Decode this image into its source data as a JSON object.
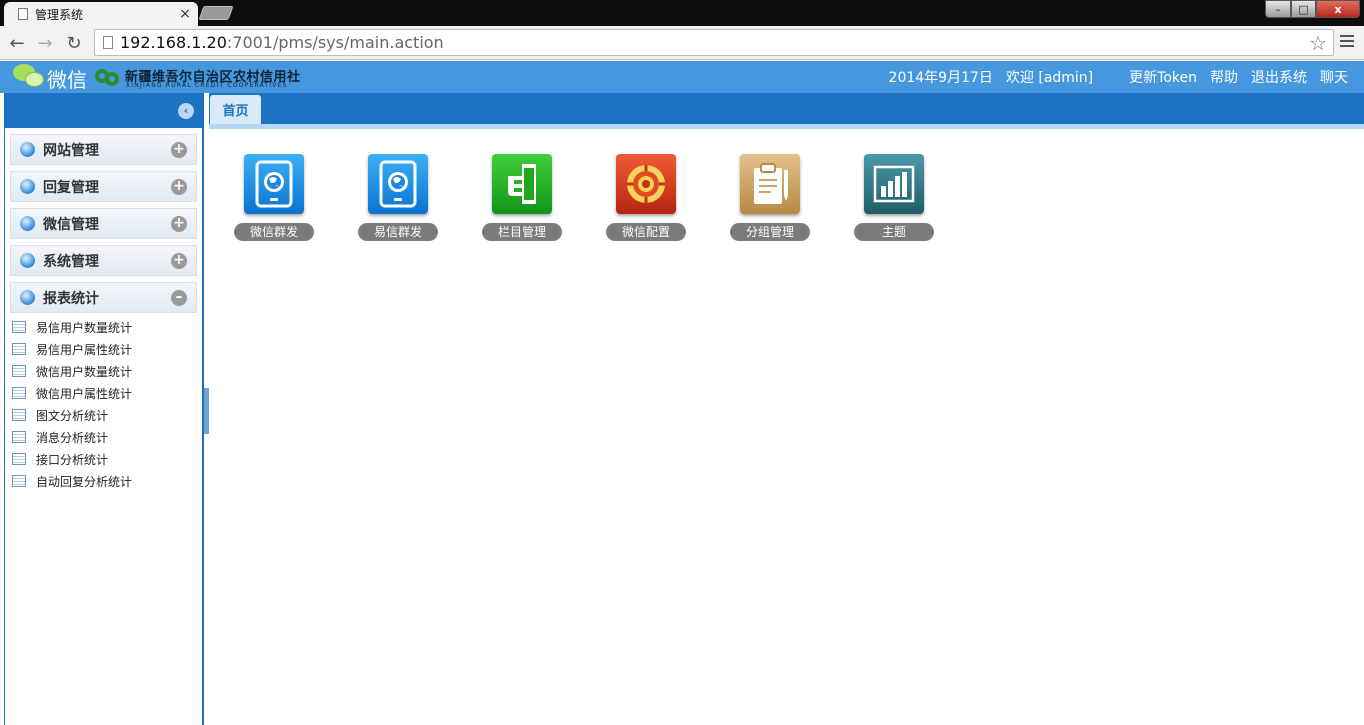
{
  "browser": {
    "tab_title": "管理系统",
    "tab_close": "×",
    "window_controls": {
      "minimize": "–",
      "maximize": "□",
      "close": "x"
    },
    "url_host": "192.168.1.20",
    "url_rest": ":7001/pms/sys/main.action",
    "back_icon": "←",
    "forward_icon": "→",
    "reload_icon": "↻",
    "bookmark_icon": "☆"
  },
  "header": {
    "wechat_label": "微信",
    "bank_name": "新疆维吾尔自治区农村信用社",
    "bank_name_en": "XINJIANG RURAL CREDIT COOPERATIVES",
    "date": "2014年9月17日",
    "welcome": "欢迎 [admin]",
    "links": {
      "update_token": "更新Token",
      "help": "帮助",
      "logout": "退出系统",
      "chat": "聊天"
    },
    "accent_color": "#4597de"
  },
  "sidebar": {
    "collapse_icon": "‹",
    "groups": [
      {
        "label": "网站管理",
        "toggle": "+"
      },
      {
        "label": "回复管理",
        "toggle": "+"
      },
      {
        "label": "微信管理",
        "toggle": "+"
      },
      {
        "label": "系统管理",
        "toggle": "+"
      },
      {
        "label": "报表统计",
        "toggle": "–"
      }
    ],
    "report_items": [
      "易信用户数量统计",
      "易信用户属性统计",
      "微信用户数量统计",
      "微信用户属性统计",
      "图文分析统计",
      "消息分析统计",
      "接口分析统计",
      "自动回复分析统计"
    ]
  },
  "main": {
    "tab_label": "首页",
    "tiles": [
      {
        "label": "微信群发",
        "icon": "tablet-globe-icon",
        "color": "#1e8ee6"
      },
      {
        "label": "易信群发",
        "icon": "tablet-globe-icon",
        "color": "#1e8ee6"
      },
      {
        "label": "栏目管理",
        "icon": "hand-door-icon",
        "color": "#1fa81f"
      },
      {
        "label": "微信配置",
        "icon": "target-config-icon",
        "color": "#d8381a"
      },
      {
        "label": "分组管理",
        "icon": "clipboard-icon",
        "color": "#c89a55"
      },
      {
        "label": "主题",
        "icon": "bar-chart-icon",
        "color": "#2f7585"
      }
    ]
  }
}
